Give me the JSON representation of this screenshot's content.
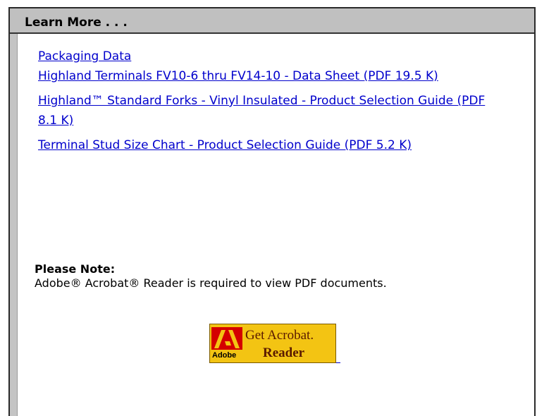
{
  "section": {
    "title": "Learn More . . ."
  },
  "links": [
    {
      "text": "Packaging Data"
    },
    {
      "text": "Highland Terminals FV10-6 thru FV14-10 - Data Sheet (PDF 19.5 K)"
    },
    {
      "text": "Highland™ Standard Forks - Vinyl Insulated - Product Selection Guide (PDF 8.1 K)"
    },
    {
      "text": "Terminal Stud Size Chart - Product Selection Guide (PDF 5.2 K)"
    }
  ],
  "note": {
    "title": "Please Note:",
    "text": "Adobe® Acrobat® Reader is required to view PDF documents."
  },
  "acrobat_badge": {
    "line1": "Get Acrobat.",
    "line2": "Reader",
    "brand": "Adobe",
    "icon": "adobe-logo-icon"
  },
  "colors": {
    "link": "#0000cc",
    "header_bg": "#c0c0c0",
    "badge_bg": "#f3c413",
    "adobe_red": "#d40000"
  }
}
